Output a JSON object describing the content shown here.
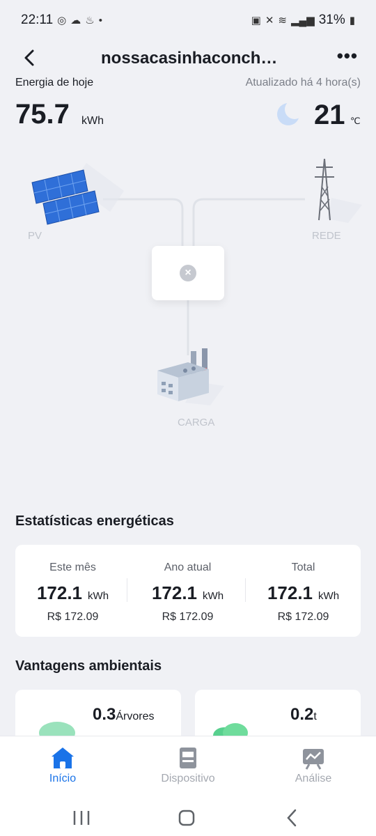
{
  "status_bar": {
    "time": "22:11",
    "dot": "•",
    "battery": "31%"
  },
  "header": {
    "title": "nossacasinhaconch…"
  },
  "summary": {
    "energy_label": "Energia de hoje",
    "updated": "Atualizado há 4 hora(s)",
    "energy_value": "75.7",
    "energy_unit": "kWh",
    "temperature": "21",
    "temperature_unit": "℃"
  },
  "flow": {
    "pv_label": "PV",
    "grid_label": "REDE",
    "load_label": "CARGA"
  },
  "stats": {
    "title": "Estatísticas energéticas",
    "items": [
      {
        "label": "Este mês",
        "value": "172.1",
        "unit": "kWh",
        "money": "R$ 172.09"
      },
      {
        "label": "Ano atual",
        "value": "172.1",
        "unit": "kWh",
        "money": "R$ 172.09"
      },
      {
        "label": "Total",
        "value": "172.1",
        "unit": "kWh",
        "money": "R$ 172.09"
      }
    ]
  },
  "environment": {
    "title": "Vantagens ambientais",
    "trees_value": "0.3",
    "trees_unit": "Árvores",
    "co2_value": "0.2",
    "co2_unit": "t"
  },
  "nav": {
    "items": [
      {
        "label": "Início",
        "icon": "home-icon",
        "active": true
      },
      {
        "label": "Dispositivo",
        "icon": "device-icon",
        "active": false
      },
      {
        "label": "Análise",
        "icon": "analysis-icon",
        "active": false
      }
    ]
  },
  "colors": {
    "accent": "#1a73e8",
    "background": "#f0f1f5",
    "solar_panel": "#2f6fd8",
    "moon": "#c9dcf7"
  }
}
